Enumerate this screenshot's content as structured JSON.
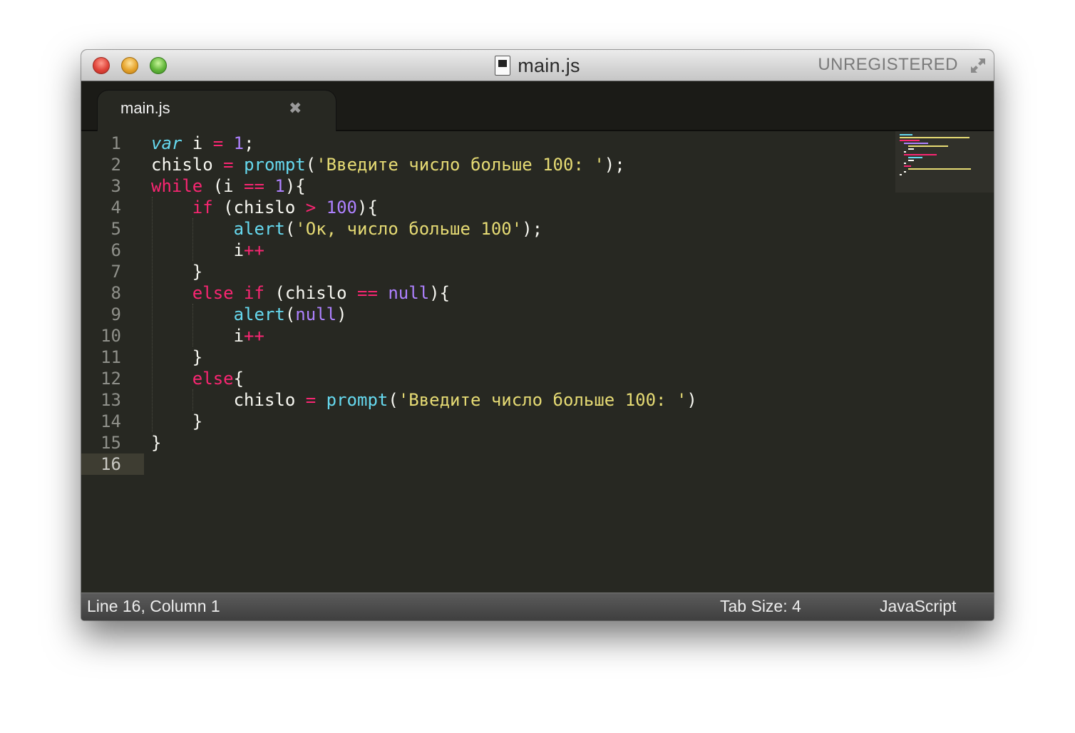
{
  "window": {
    "title": "main.js",
    "unregistered_label": "UNREGISTERED"
  },
  "tab": {
    "label": "main.js",
    "close_glyph": "✖"
  },
  "gutter": {
    "line_numbers": [
      "1",
      "2",
      "3",
      "4",
      "5",
      "6",
      "7",
      "8",
      "9",
      "10",
      "11",
      "12",
      "13",
      "14",
      "15",
      "16"
    ],
    "active_line": 16
  },
  "code": {
    "l1": {
      "a": "var",
      "b": " i ",
      "c": "=",
      "d": " ",
      "e": "1",
      "f": ";"
    },
    "l2": {
      "a": "chislo ",
      "b": "=",
      "c": " ",
      "d": "prompt",
      "e": "(",
      "f": "'Введите число больше 100: '",
      "g": ");"
    },
    "l3": {
      "a": "while",
      "b": " (i ",
      "c": "==",
      "d": " ",
      "e": "1",
      "f": "){"
    },
    "l4": {
      "a": "    ",
      "b": "if",
      "c": " (chislo ",
      "d": ">",
      "e": " ",
      "f": "100",
      "g": "){"
    },
    "l5": {
      "a": "        ",
      "b": "alert",
      "c": "(",
      "d": "'Ок, число больше 100'",
      "e": ");"
    },
    "l6": {
      "a": "        i",
      "b": "++"
    },
    "l7": {
      "a": "    }"
    },
    "l8": {
      "a": "    ",
      "b": "else",
      "c": " ",
      "d": "if",
      "e": " (chislo ",
      "f": "==",
      "g": " ",
      "h": "null",
      "i": "){"
    },
    "l9": {
      "a": "        ",
      "b": "alert",
      "c": "(",
      "d": "null",
      "e": ")"
    },
    "l10": {
      "a": "        i",
      "b": "++"
    },
    "l11": {
      "a": "    }"
    },
    "l12": {
      "a": "    ",
      "b": "else",
      "c": "{"
    },
    "l13": {
      "a": "        chislo ",
      "b": "=",
      "c": " ",
      "d": "prompt",
      "e": "(",
      "f": "'Введите число больше 100: '",
      "g": ")"
    },
    "l14": {
      "a": "    }"
    },
    "l15": {
      "a": "}"
    },
    "l16": {
      "a": ""
    }
  },
  "status": {
    "position": "Line 16, Column 1",
    "tab_size": "Tab Size: 4",
    "syntax": "JavaScript"
  },
  "colors": {
    "editor_bg": "#272822",
    "keyword": "#f92672",
    "string": "#e6db74",
    "number": "#ae81ff",
    "function": "#66d9ef",
    "text": "#f8f8f2"
  },
  "icons": [
    "file-icon",
    "fullscreen-icon",
    "tab-close-icon"
  ]
}
